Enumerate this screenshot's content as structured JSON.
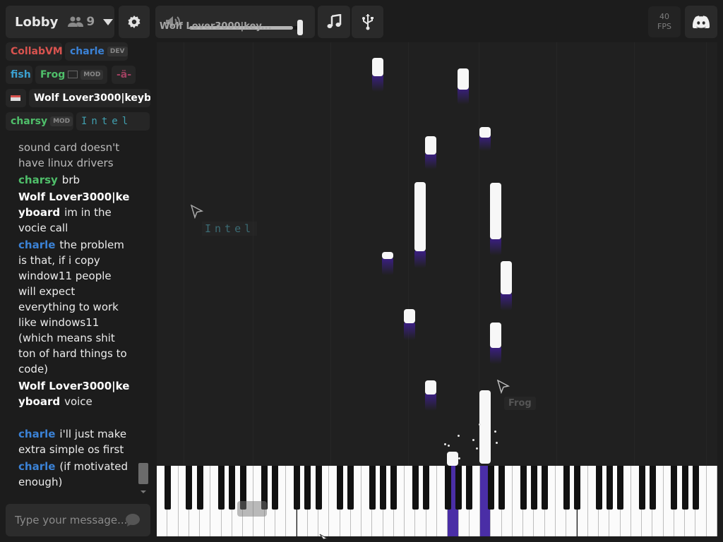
{
  "header": {
    "room_name": "Lobby",
    "user_count": "9",
    "volume_user": "Wolf Lover3000|key...",
    "volume_level": 0.92,
    "fps_value": "40",
    "fps_label": "FPS"
  },
  "icons": {
    "people": "people-icon",
    "caret": "chevron-down-icon",
    "settings": "gear-icon",
    "volume": "speaker-icon",
    "music": "music-note-icon",
    "usb": "usb-icon",
    "discord": "discord-icon",
    "send": "speech-bubble-icon"
  },
  "users": [
    {
      "name": "CollabVM",
      "color": "#d9534f"
    },
    {
      "name": "charle",
      "color": "#3b82d6",
      "badge": "DEV"
    },
    {
      "name": "fish",
      "color": "#3ba0d0"
    },
    {
      "name": "Frog",
      "color": "#4fbf6a",
      "badge": "MOD"
    },
    {
      "name": "-ä-",
      "color": "#a04060"
    },
    {
      "name": "Wolf Lover3000|keyb...",
      "color": "#ffffff"
    },
    {
      "name": "charsy",
      "color": "#4fbf6a",
      "badge": "MOD"
    },
    {
      "name": "Intel",
      "color": "#40a0b0"
    }
  ],
  "chat": {
    "messages": [
      {
        "user": "",
        "user_color": "#ececec",
        "text": "sound card doesn't have linux drivers"
      },
      {
        "user": "charsy",
        "user_color": "#4fbf6a",
        "text": "brb"
      },
      {
        "user": "Wolf Lover3000|keyboard",
        "user_color": "#ffffff",
        "text": "im in the vocie call"
      },
      {
        "user": "charle",
        "user_color": "#3b82d6",
        "text": "the problem is that, if i copy window11 people will expect everything to work like windows11 (which means shit ton of hard things to code)"
      },
      {
        "user": "Wolf Lover3000|keyboard",
        "user_color": "#ffffff",
        "text": "voice"
      },
      {
        "user": "charle",
        "user_color": "#3b82d6",
        "text": "i'll just make extra simple os first"
      },
      {
        "user": "charle",
        "user_color": "#3b82d6",
        "text": "(if motivated enough)"
      }
    ],
    "input_placeholder": "Type your message..."
  },
  "cursors": {
    "intel_label": "Intel",
    "frog_label": "Frog"
  },
  "accent_color": "#4a2ea6"
}
